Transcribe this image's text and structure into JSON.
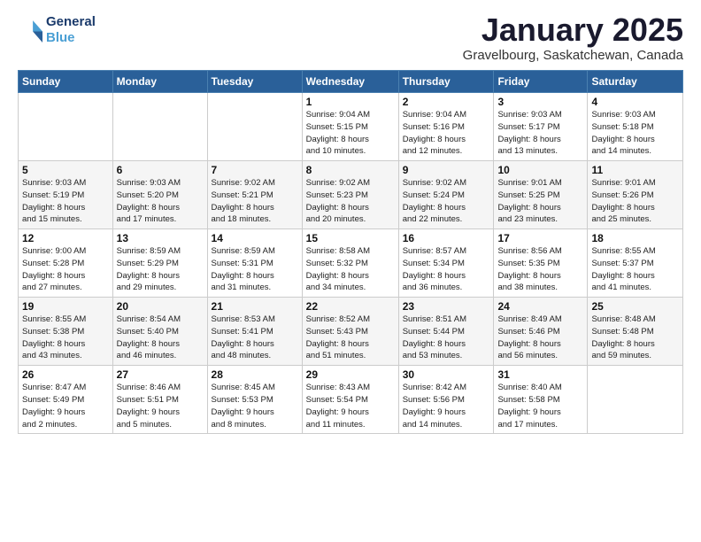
{
  "logo": {
    "line1": "General",
    "line2": "Blue"
  },
  "title": "January 2025",
  "location": "Gravelbourg, Saskatchewan, Canada",
  "weekdays": [
    "Sunday",
    "Monday",
    "Tuesday",
    "Wednesday",
    "Thursday",
    "Friday",
    "Saturday"
  ],
  "weeks": [
    [
      {
        "day": "",
        "info": ""
      },
      {
        "day": "",
        "info": ""
      },
      {
        "day": "",
        "info": ""
      },
      {
        "day": "1",
        "info": "Sunrise: 9:04 AM\nSunset: 5:15 PM\nDaylight: 8 hours\nand 10 minutes."
      },
      {
        "day": "2",
        "info": "Sunrise: 9:04 AM\nSunset: 5:16 PM\nDaylight: 8 hours\nand 12 minutes."
      },
      {
        "day": "3",
        "info": "Sunrise: 9:03 AM\nSunset: 5:17 PM\nDaylight: 8 hours\nand 13 minutes."
      },
      {
        "day": "4",
        "info": "Sunrise: 9:03 AM\nSunset: 5:18 PM\nDaylight: 8 hours\nand 14 minutes."
      }
    ],
    [
      {
        "day": "5",
        "info": "Sunrise: 9:03 AM\nSunset: 5:19 PM\nDaylight: 8 hours\nand 15 minutes."
      },
      {
        "day": "6",
        "info": "Sunrise: 9:03 AM\nSunset: 5:20 PM\nDaylight: 8 hours\nand 17 minutes."
      },
      {
        "day": "7",
        "info": "Sunrise: 9:02 AM\nSunset: 5:21 PM\nDaylight: 8 hours\nand 18 minutes."
      },
      {
        "day": "8",
        "info": "Sunrise: 9:02 AM\nSunset: 5:23 PM\nDaylight: 8 hours\nand 20 minutes."
      },
      {
        "day": "9",
        "info": "Sunrise: 9:02 AM\nSunset: 5:24 PM\nDaylight: 8 hours\nand 22 minutes."
      },
      {
        "day": "10",
        "info": "Sunrise: 9:01 AM\nSunset: 5:25 PM\nDaylight: 8 hours\nand 23 minutes."
      },
      {
        "day": "11",
        "info": "Sunrise: 9:01 AM\nSunset: 5:26 PM\nDaylight: 8 hours\nand 25 minutes."
      }
    ],
    [
      {
        "day": "12",
        "info": "Sunrise: 9:00 AM\nSunset: 5:28 PM\nDaylight: 8 hours\nand 27 minutes."
      },
      {
        "day": "13",
        "info": "Sunrise: 8:59 AM\nSunset: 5:29 PM\nDaylight: 8 hours\nand 29 minutes."
      },
      {
        "day": "14",
        "info": "Sunrise: 8:59 AM\nSunset: 5:31 PM\nDaylight: 8 hours\nand 31 minutes."
      },
      {
        "day": "15",
        "info": "Sunrise: 8:58 AM\nSunset: 5:32 PM\nDaylight: 8 hours\nand 34 minutes."
      },
      {
        "day": "16",
        "info": "Sunrise: 8:57 AM\nSunset: 5:34 PM\nDaylight: 8 hours\nand 36 minutes."
      },
      {
        "day": "17",
        "info": "Sunrise: 8:56 AM\nSunset: 5:35 PM\nDaylight: 8 hours\nand 38 minutes."
      },
      {
        "day": "18",
        "info": "Sunrise: 8:55 AM\nSunset: 5:37 PM\nDaylight: 8 hours\nand 41 minutes."
      }
    ],
    [
      {
        "day": "19",
        "info": "Sunrise: 8:55 AM\nSunset: 5:38 PM\nDaylight: 8 hours\nand 43 minutes."
      },
      {
        "day": "20",
        "info": "Sunrise: 8:54 AM\nSunset: 5:40 PM\nDaylight: 8 hours\nand 46 minutes."
      },
      {
        "day": "21",
        "info": "Sunrise: 8:53 AM\nSunset: 5:41 PM\nDaylight: 8 hours\nand 48 minutes."
      },
      {
        "day": "22",
        "info": "Sunrise: 8:52 AM\nSunset: 5:43 PM\nDaylight: 8 hours\nand 51 minutes."
      },
      {
        "day": "23",
        "info": "Sunrise: 8:51 AM\nSunset: 5:44 PM\nDaylight: 8 hours\nand 53 minutes."
      },
      {
        "day": "24",
        "info": "Sunrise: 8:49 AM\nSunset: 5:46 PM\nDaylight: 8 hours\nand 56 minutes."
      },
      {
        "day": "25",
        "info": "Sunrise: 8:48 AM\nSunset: 5:48 PM\nDaylight: 8 hours\nand 59 minutes."
      }
    ],
    [
      {
        "day": "26",
        "info": "Sunrise: 8:47 AM\nSunset: 5:49 PM\nDaylight: 9 hours\nand 2 minutes."
      },
      {
        "day": "27",
        "info": "Sunrise: 8:46 AM\nSunset: 5:51 PM\nDaylight: 9 hours\nand 5 minutes."
      },
      {
        "day": "28",
        "info": "Sunrise: 8:45 AM\nSunset: 5:53 PM\nDaylight: 9 hours\nand 8 minutes."
      },
      {
        "day": "29",
        "info": "Sunrise: 8:43 AM\nSunset: 5:54 PM\nDaylight: 9 hours\nand 11 minutes."
      },
      {
        "day": "30",
        "info": "Sunrise: 8:42 AM\nSunset: 5:56 PM\nDaylight: 9 hours\nand 14 minutes."
      },
      {
        "day": "31",
        "info": "Sunrise: 8:40 AM\nSunset: 5:58 PM\nDaylight: 9 hours\nand 17 minutes."
      },
      {
        "day": "",
        "info": ""
      }
    ]
  ]
}
